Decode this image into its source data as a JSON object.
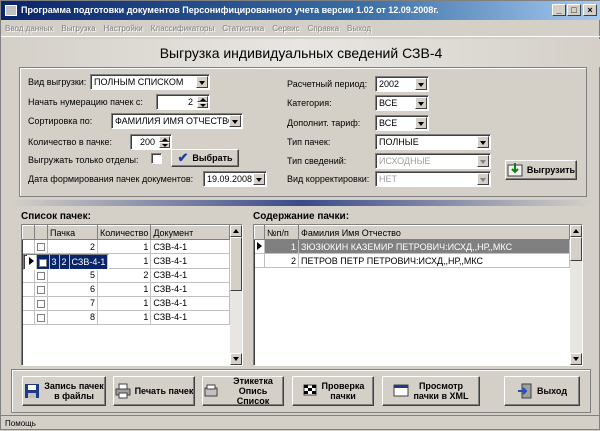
{
  "window": {
    "title": "Программа подготовки документов Персонифицированного учета версии 1.02 от 12.09.2008г."
  },
  "menu": [
    "Ввод данных",
    "Выгрузка",
    "Настройки",
    "Классификаторы",
    "Статистика",
    "Сервис",
    "Справка",
    "Выход"
  ],
  "form_title": "Выгрузка индивидуальных сведений СЗВ-4",
  "left": {
    "vid_label": "Вид выгрузки:",
    "vid_value": "ПОЛНЫМ СПИСКОМ",
    "start_label": "Начать нумерацию пачек с:",
    "start_value": "2",
    "sort_label": "Сортировка по:",
    "sort_value": "ФАМИЛИЯ ИМЯ ОТЧЕСТВО",
    "count_label": "Количество в пачке:",
    "count_value": "200",
    "only_dept_label": "Выгружать только отделы:",
    "choose_label": "Выбрать",
    "date_label": "Дата формирования пачек документов:",
    "date_value": "19.09.2008"
  },
  "right": {
    "period_label": "Расчетный период:",
    "period_value": "2002",
    "category_label": "Категория:",
    "category_value": "ВСЕ",
    "tariff_label": "Дополнит. тариф:",
    "tariff_value": "ВСЕ",
    "pack_type_label": "Тип пачек:",
    "pack_type_value": "ПОЛНЫЕ",
    "info_type_label": "Тип сведений:",
    "info_type_value": "ИСХОДНЫЕ",
    "corr_label": "Вид корректировки:",
    "corr_value": "НЕТ",
    "export_label": "Выгрузить"
  },
  "packs": {
    "title": "Список пачек:",
    "headers": [
      "Пачка",
      "Количество",
      "Документ"
    ],
    "rows": [
      {
        "pack": "2",
        "count": "1",
        "doc": "СЗВ-4-1"
      },
      {
        "pack": "3",
        "count": "2",
        "doc": "СЗВ-4-1"
      },
      {
        "pack": "4",
        "count": "1",
        "doc": "СЗВ-4-1"
      },
      {
        "pack": "5",
        "count": "2",
        "doc": "СЗВ-4-1"
      },
      {
        "pack": "6",
        "count": "1",
        "doc": "СЗВ-4-1"
      },
      {
        "pack": "7",
        "count": "1",
        "doc": "СЗВ-4-1"
      },
      {
        "pack": "8",
        "count": "1",
        "doc": "СЗВ-4-1"
      }
    ]
  },
  "content": {
    "title": "Содержание пачки:",
    "headers": [
      "№п/п",
      "Фамилия Имя Отчество"
    ],
    "rows": [
      {
        "n": "1",
        "name": "ЗЮЗЮКИН КАЗЕМИР ПЕТРОВИЧ:ИСХД,,НР,,МКС"
      },
      {
        "n": "2",
        "name": "ПЕТРОВ ПЕТР ПЕТРОВИЧ:ИСХД,,НР,,МКС"
      }
    ]
  },
  "buttons": {
    "save": [
      "Запись пачек",
      "в файлы"
    ],
    "print": "Печать пачек",
    "label": [
      "Этикетка",
      "Опись Список"
    ],
    "check": [
      "Проверка",
      "пачки"
    ],
    "view": [
      "Просмотр",
      "пачки в XML"
    ],
    "exit": "Выход"
  },
  "status": "Помощь"
}
